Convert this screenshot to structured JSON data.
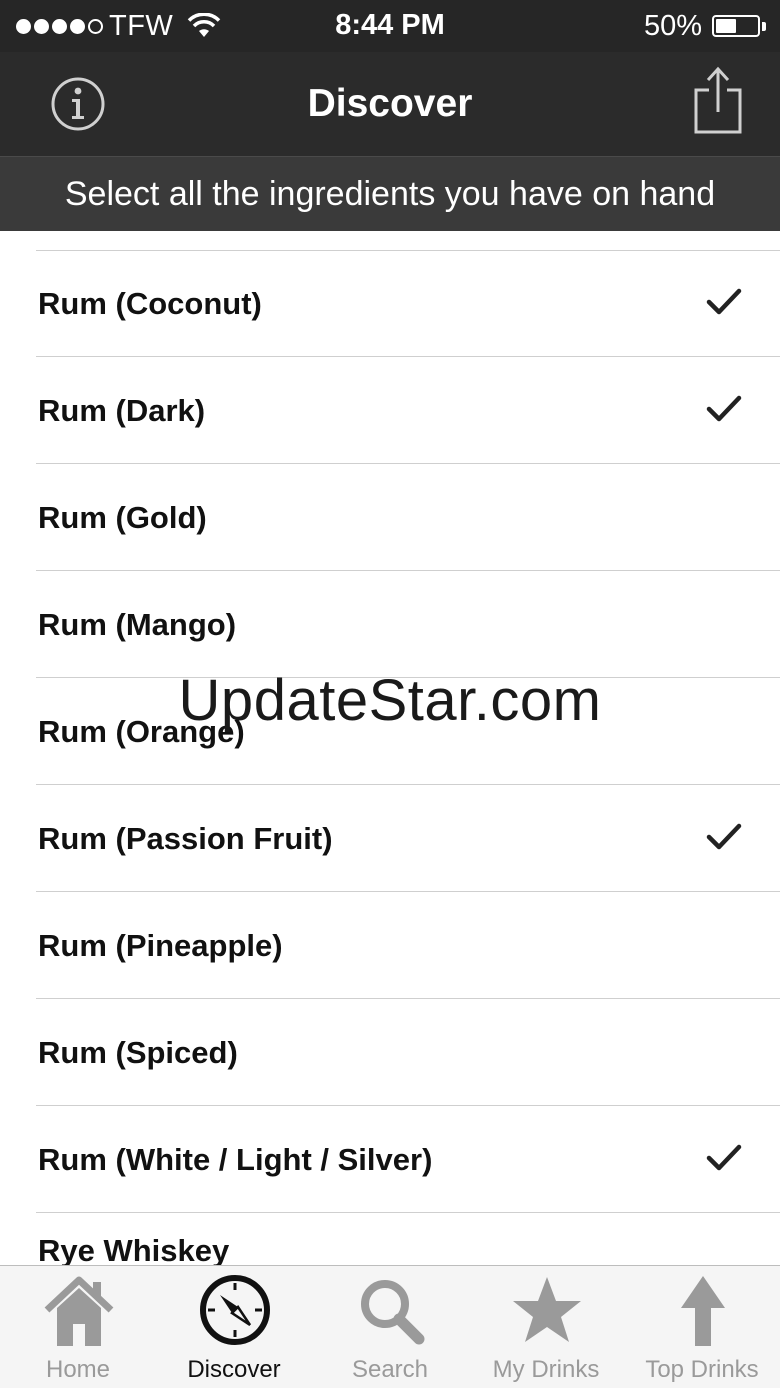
{
  "status_bar": {
    "carrier": "TFW",
    "signal_bars_filled": 4,
    "signal_bars_total": 5,
    "time": "8:44 PM",
    "battery_percent": "50%",
    "battery_level": 0.5
  },
  "nav": {
    "title": "Discover",
    "left_icon": "info-icon",
    "right_icon": "share-icon"
  },
  "banner": {
    "text": "Select all the ingredients you have on hand"
  },
  "ingredients": [
    {
      "label": "Rum (Coconut)",
      "checked": true
    },
    {
      "label": "Rum (Dark)",
      "checked": true
    },
    {
      "label": "Rum (Gold)",
      "checked": false
    },
    {
      "label": "Rum (Mango)",
      "checked": false
    },
    {
      "label": "Rum (Orange)",
      "checked": false
    },
    {
      "label": "Rum (Passion Fruit)",
      "checked": true
    },
    {
      "label": "Rum (Pineapple)",
      "checked": false
    },
    {
      "label": "Rum (Spiced)",
      "checked": false
    },
    {
      "label": "Rum (White / Light / Silver)",
      "checked": true
    },
    {
      "label": "Rye Whiskey",
      "checked": false
    }
  ],
  "watermark": "UpdateStar.com",
  "tabs": [
    {
      "label": "Home",
      "icon": "home-icon",
      "active": false
    },
    {
      "label": "Discover",
      "icon": "compass-icon",
      "active": true
    },
    {
      "label": "Search",
      "icon": "search-icon",
      "active": false
    },
    {
      "label": "My Drinks",
      "icon": "star-icon",
      "active": false
    },
    {
      "label": "Top Drinks",
      "icon": "arrow-up-icon",
      "active": false
    }
  ],
  "colors": {
    "bar_dark": "#2b2b2b",
    "banner": "#3a3a3a",
    "tab_inactive": "#9a9a9a",
    "tab_active": "#111111"
  }
}
